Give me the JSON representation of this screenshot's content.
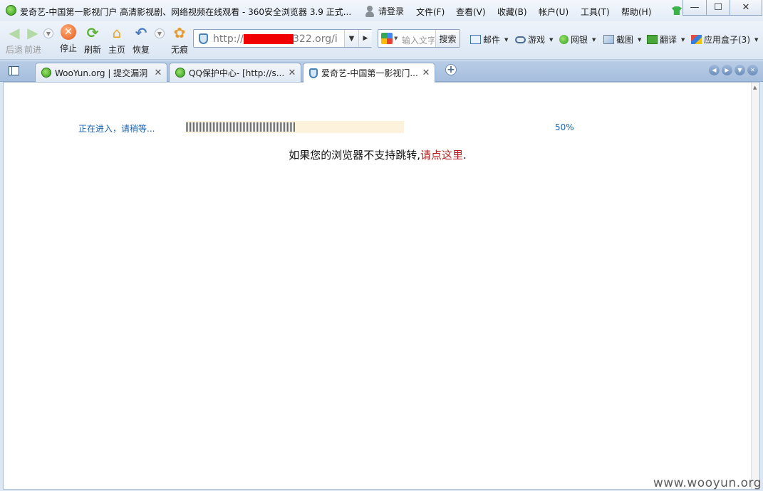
{
  "window": {
    "title": "爱奇艺-中国第一影视门户 高清影视剧、网络视频在线观看 - 360安全浏览器 3.9 正式...",
    "login": "请登录",
    "menus": [
      "文件(F)",
      "查看(V)",
      "收藏(B)",
      "帐户(U)",
      "工具(T)",
      "帮助(H)"
    ],
    "controls": {
      "minimize": "—",
      "maximize": "☐",
      "close": "✕"
    }
  },
  "toolbar": {
    "back": "后退",
    "forward": "前进",
    "stop": "停止",
    "refresh": "刷新",
    "home": "主页",
    "restore": "恢复",
    "incognito": "无痕"
  },
  "address": {
    "prefix": "http://",
    "suffix": "322.org/i"
  },
  "search": {
    "placeholder": "输入文字",
    "button": "搜索"
  },
  "tools": [
    "邮件",
    "游戏",
    "网银",
    "截图",
    "翻译",
    "应用盒子(3)"
  ],
  "tabs": [
    {
      "label": "WooYun.org | 提交漏洞",
      "active": false
    },
    {
      "label": "QQ保护中心- [http://s...",
      "active": false
    },
    {
      "label": "爱奇艺-中国第一影视门...",
      "active": true
    }
  ],
  "page": {
    "loading_text": "正在进入，请稍等...",
    "progress_percent": 50,
    "percent_label": "50%",
    "redirect_prefix": "如果您的浏览器不支持跳转,",
    "redirect_link": "请点这里",
    "redirect_suffix": "."
  },
  "watermark": "www.wooyun.org",
  "colors": {
    "accent": "#1d64ad",
    "link": "#b5181c",
    "progress_bar": "#3d6eb1",
    "progress_track": "#fdf3dc",
    "redaction": "#f00000"
  }
}
